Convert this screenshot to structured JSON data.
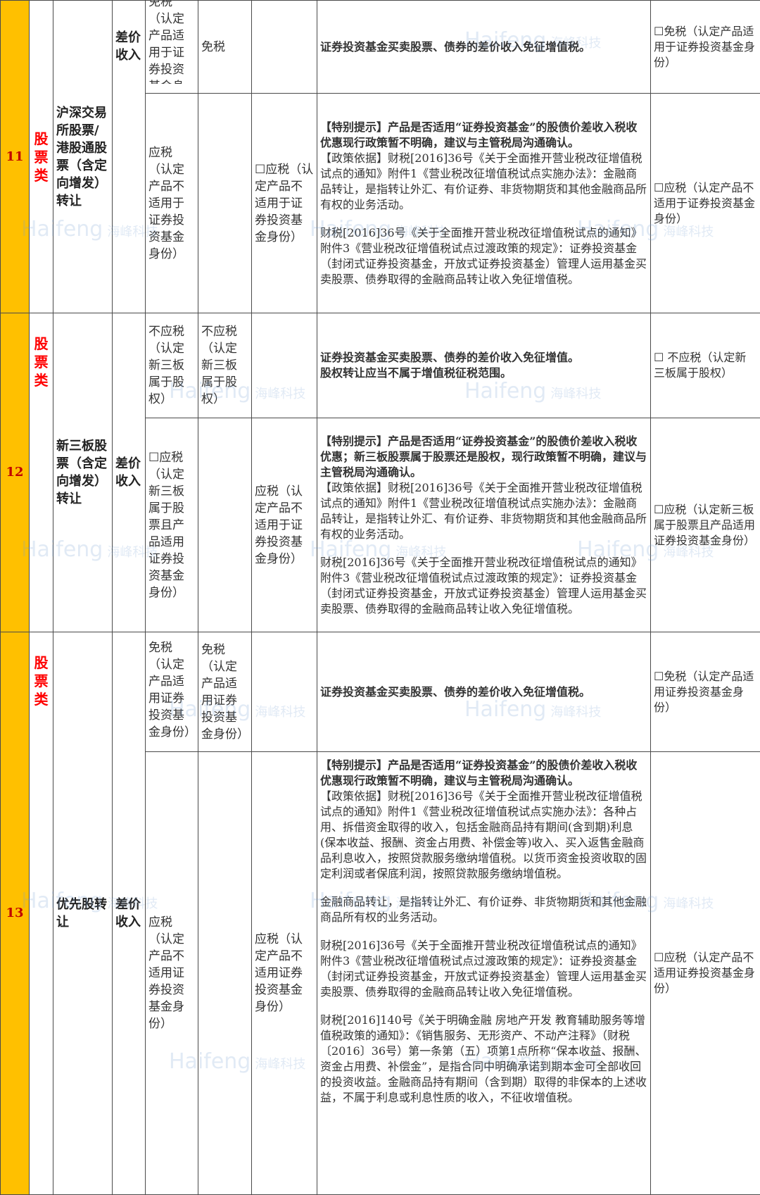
{
  "rows": {
    "r11": {
      "num": "11",
      "category": "股票类",
      "name": "沪深交易所股票/港股通股票（含定向增发）转让",
      "income": "差价收入",
      "sub1": {
        "c5": "免税（认定产品适用于证券投资基金身份）",
        "c6": "免税",
        "c7": "",
        "note": "证券投资基金买卖股票、债券的差价收入免征增值税。",
        "choice": "☐免税（认定产品适用于证券投资基金身份）"
      },
      "sub2": {
        "c5": "应税（认定产品不适用于证券投资基金身份）",
        "c6": "",
        "c7": "☐应税（认定产品不适用于证券投资基金身份）",
        "note_tip_label": "【特别提示】",
        "note_tip_text": "产品是否适用“证券投资基金”的股债价差收入税收优惠现行政策暂不明确，建议与主管税局沟通确认。",
        "note_basis_label": "【政策依据】",
        "note_basis_text": "财税[2016]36号《关于全面推开营业税改征增值税试点的通知》附件1《营业税改征增值税试点实施办法》：金融商品转让，是指转让外汇、有价证券、非货物期货和其他金融商品所有权的业务活动。",
        "note_p2": "财税[2016]36号《关于全面推开营业税改征增值税试点的通知》附件3《营业税改征增值税试点过渡政策的规定》：证券投资基金（封闭式证券投资基金，开放式证券投资基金）管理人运用基金买卖股票、债券取得的金融商品转让收入免征增值税。",
        "choice": "☐应税（认定产品不适用于证券投资基金身份）"
      }
    },
    "r12": {
      "num": "12",
      "category": "股票类",
      "name": "新三板股票（含定向增发）转让",
      "income": "差价收入",
      "sub1": {
        "c5": "不应税（认定新三板属于股权）",
        "c6": "不应税（认定新三板属于股权）",
        "c7": "",
        "note_l1": "证券投资基金买卖股票、债券的差价收入免征增值。",
        "note_l2": "股权转让应当不属于增值税征税范围。",
        "choice": "☐ 不应税（认定新三板属于股权）"
      },
      "sub2": {
        "c5": "☐应税（认定新三板属于股票且产品适用证券投资基金身份）",
        "c6": "",
        "c7": "应税（认定产品不适用于证券投资基金身份）",
        "note_tip_label": "【特别提示】",
        "note_tip_text": "产品是否适用“证券投资基金”的股债价差收入税收优惠；新三板股票属于股票还是股权，现行政策暂不明确，建议与主管税局沟通确认。",
        "note_basis_label": "【政策依据】",
        "note_basis_text": "财税[2016]36号《关于全面推开营业税改征增值税试点的通知》附件1《营业税改征增值税试点实施办法》：金融商品转让，是指转让外汇、有价证券、非货物期货和其他金融商品所有权的业务活动。",
        "note_p2": "财税[2016]36号《关于全面推开营业税改征增值税试点的通知》附件3《营业税改征增值税试点过渡政策的规定》：证券投资基金（封闭式证券投资基金，开放式证券投资基金）管理人运用基金买卖股票、债券取得的金融商品转让收入免征增值税。",
        "choice": "☐应税（认定新三板属于股票且产品适用证券投资基金身份）"
      }
    },
    "r13": {
      "num": "13",
      "category": "股票类",
      "name": "优先股转让",
      "income": "差价收入",
      "sub1": {
        "c5": "免税（认定产品适用证券投资基金身份）",
        "c6": "免税（认定产品适用证券投资基金身份）",
        "c7": "",
        "note": "证券投资基金买卖股票、债券的差价收入免征增值税。",
        "choice": "☐免税（认定产品适用证券投资基金身份）"
      },
      "sub2": {
        "c5": "应税（认定产品不适用证券投资基金身份）",
        "c6": "",
        "c7": "应税（认定产品不适用证券投资基金身份）",
        "note_tip_label": "【特别提示】",
        "note_tip_text": "产品是否适用“证券投资基金”的股债价差收入税收优惠现行政策暂不明确，建议与主管税局沟通确认。",
        "note_basis_label": "【政策依据】",
        "note_basis_text": "财税[2016]36号《关于全面推开营业税改征增值税试点的通知》附件1《营业税改征增值税试点实施办法》：各种占用、拆借资金取得的收入，包括金融商品持有期间(含到期)利息(保本收益、报酬、资金占用费、补偿金等)收入、买入返售金融商品利息收入，按照贷款服务缴纳增值税。以货币资金投资收取的固定利润或者保底利润，按照贷款服务缴纳增值税。",
        "note_p2": "金融商品转让，是指转让外汇、有价证券、非货物期货和其他金融商品所有权的业务活动。",
        "note_p3": "财税[2016]36号《关于全面推开营业税改征增值税试点的通知》附件3《营业税改征增值税试点过渡政策的规定》：证券投资基金（封闭式证券投资基金，开放式证券投资基金）管理人运用基金买卖股票、债券取得的金融商品转让收入免征增值税。",
        "note_p4": "财税[2016]140号《关于明确金融 房地产开发 教育辅助服务等增值税政策的通知》：《销售服务、无形资产、不动产注释》（财税〔2016〕36号）第一条第（五）项第1点所称“保本收益、报酬、资金占用费、补偿金”，是指合同中明确承诺到期本金可全部收回的投资收益。金融商品持有期间（含到期）取得的非保本的上述收益，不属于利息或利息性质的收入，不征收增值税。",
        "choice": "☐应税（认定产品不适用证券投资基金身份）"
      }
    }
  },
  "watermark": {
    "latin": "Haifeng",
    "cjk": "海峰科技"
  }
}
